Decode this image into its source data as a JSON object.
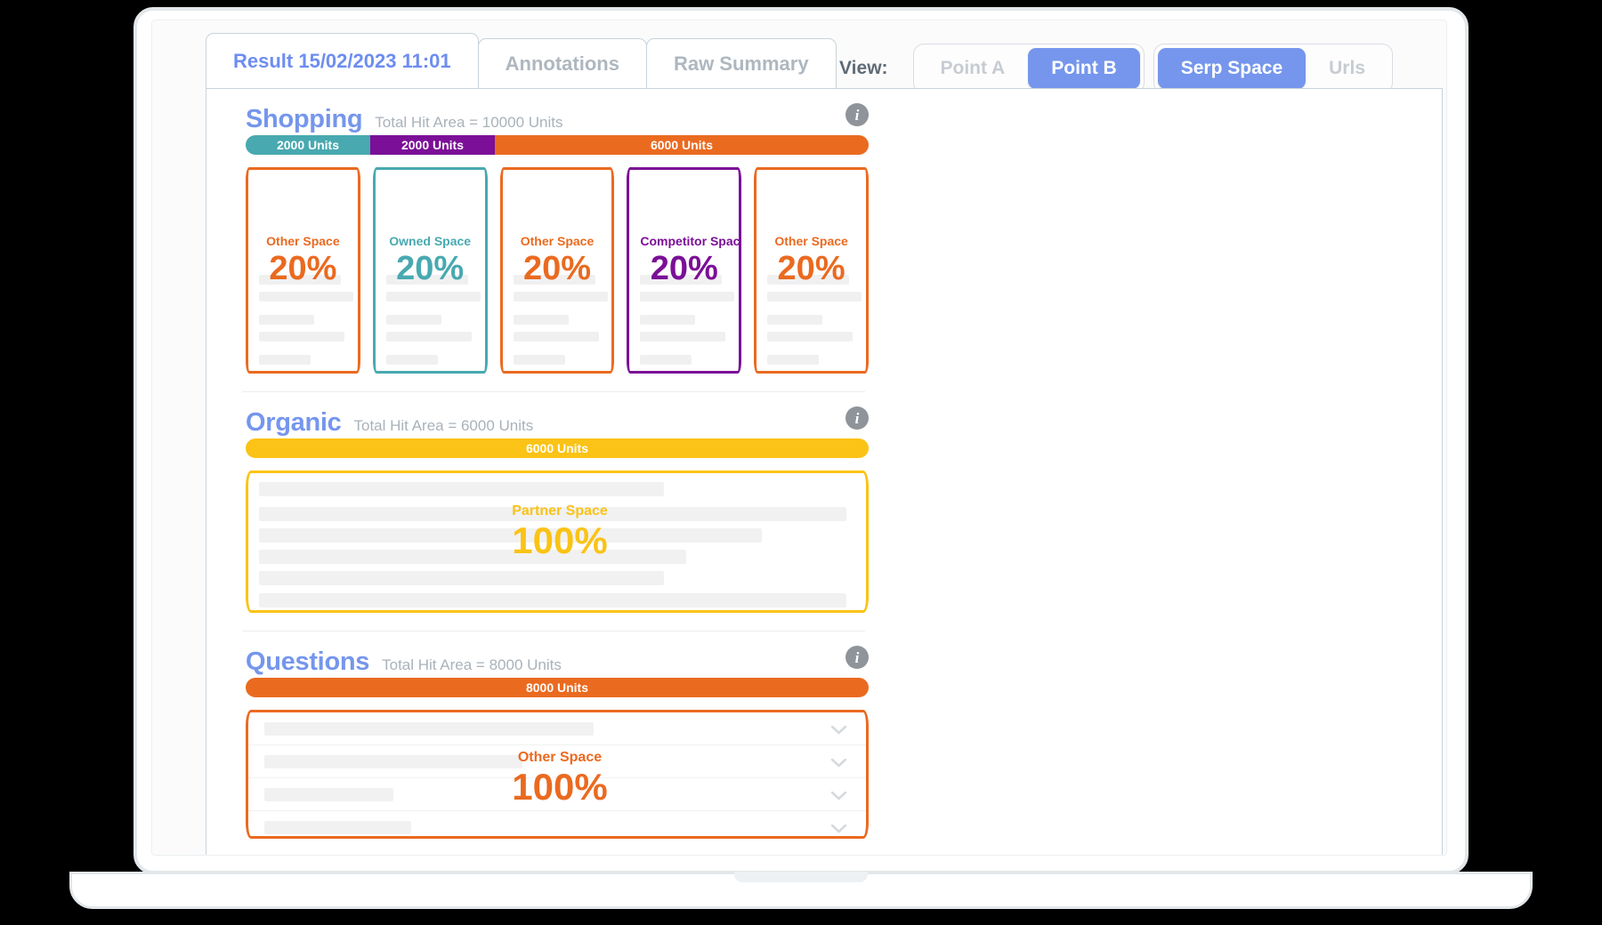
{
  "tabs": [
    {
      "label": "Result 15/02/2023 11:01",
      "active": true
    },
    {
      "label": "Annotations",
      "active": false
    },
    {
      "label": "Raw Summary",
      "active": false
    }
  ],
  "view": {
    "label": "View:",
    "group_a": [
      {
        "label": "Point A",
        "on": false
      },
      {
        "label": "Point B",
        "on": true
      }
    ],
    "group_b": [
      {
        "label": "Serp Space",
        "on": true
      },
      {
        "label": "Urls",
        "on": false
      }
    ]
  },
  "colors": {
    "accent_blue": "#7596ec",
    "orange": "#ea6a20",
    "teal": "#48a9b0",
    "purple": "#7b0f97",
    "yellow": "#fac315",
    "muted": "#a9b2ba",
    "skeleton": "#f1f1f2"
  },
  "info_icon_glyph": "i",
  "chevron_icon": "chevron-down-icon",
  "sections": [
    {
      "title": "Shopping",
      "subtitle": "Total Hit Area = 10000 Units",
      "total_units": 10000,
      "bar": [
        {
          "label": "2000 Units",
          "units": 2000,
          "color": "#48a9b0"
        },
        {
          "label": "2000 Units",
          "units": 2000,
          "color": "#7b0f97"
        },
        {
          "label": "6000 Units",
          "units": 6000,
          "color": "#ea6a20"
        }
      ],
      "cards": [
        {
          "label": "Other Space",
          "pct": "20%",
          "color": "#ea6a20"
        },
        {
          "label": "Owned Space",
          "pct": "20%",
          "color": "#48a9b0"
        },
        {
          "label": "Other Space",
          "pct": "20%",
          "color": "#ea6a20"
        },
        {
          "label": "Competitor Space",
          "pct": "20%",
          "color": "#7b0f97"
        },
        {
          "label": "Other Space",
          "pct": "20%",
          "color": "#ea6a20"
        }
      ]
    },
    {
      "title": "Organic",
      "subtitle": "Total Hit Area = 6000 Units",
      "total_units": 6000,
      "bar": [
        {
          "label": "6000 Units",
          "units": 6000,
          "color": "#fac315"
        }
      ],
      "card": {
        "label": "Partner Space",
        "pct": "100%",
        "color": "#fac315"
      }
    },
    {
      "title": "Questions",
      "subtitle": "Total Hit Area = 8000 Units",
      "total_units": 8000,
      "bar": [
        {
          "label": "8000 Units",
          "units": 8000,
          "color": "#ea6a20"
        }
      ],
      "card": {
        "label": "Other Space",
        "pct": "100%",
        "color": "#ea6a20"
      }
    }
  ]
}
